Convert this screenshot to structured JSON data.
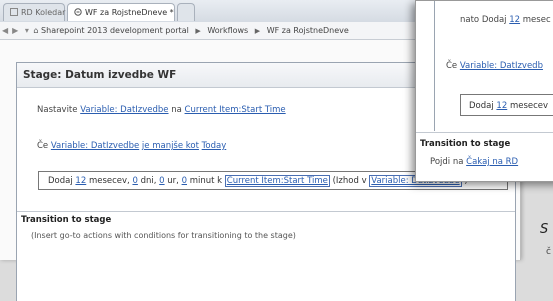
{
  "browser": {
    "tabs": [
      {
        "label": "RD Koledar",
        "active": false
      },
      {
        "label": "WF za RojstneDneve *",
        "active": true
      }
    ],
    "breadcrumb": [
      "Sharepoint 2013 development portal",
      "Workflows",
      "WF za RojstneDneve"
    ]
  },
  "stage": {
    "title": "Stage: Datum izvedbe WF",
    "set_prefix": "Nastavite",
    "set_variable": "Variable: DatIzvedbe",
    "set_mid": "na",
    "set_value": "Current Item:Start Time",
    "if_prefix": "Če",
    "if_variable": "Variable: DatIzvedbe",
    "if_operator": "je manjše kot",
    "if_value": "Today",
    "action": {
      "prefix": "Dodaj",
      "months": "12",
      "months_label": "mesecev,",
      "days": "0",
      "days_label": "dni,",
      "hours": "0",
      "hours_label": "ur,",
      "minutes": "0",
      "minutes_label": "minut k",
      "target": "Current Item:Start Time",
      "output_prefix": "(Izhod v",
      "output_var": "Variable: DatIzvedbe",
      "output_suffix": ")"
    },
    "transition_title": "Transition to stage",
    "transition_hint": "(Insert go-to actions with conditions for transitioning to the stage)"
  },
  "popup": {
    "line1_prefix": "nato Dodaj",
    "line1_num": "12",
    "line1_suffix": "mesec",
    "line2_prefix": "Če",
    "line2_var": "Variable: DatIzvedb",
    "action_prefix": "Dodaj",
    "action_num": "12",
    "action_suffix": "mesecev",
    "transition_title": "Transition to stage",
    "goto_prefix": "Pojdi na",
    "goto_target": "Čakaj na RD"
  },
  "margin_text": {
    "letter": "S",
    "mark": "č"
  }
}
